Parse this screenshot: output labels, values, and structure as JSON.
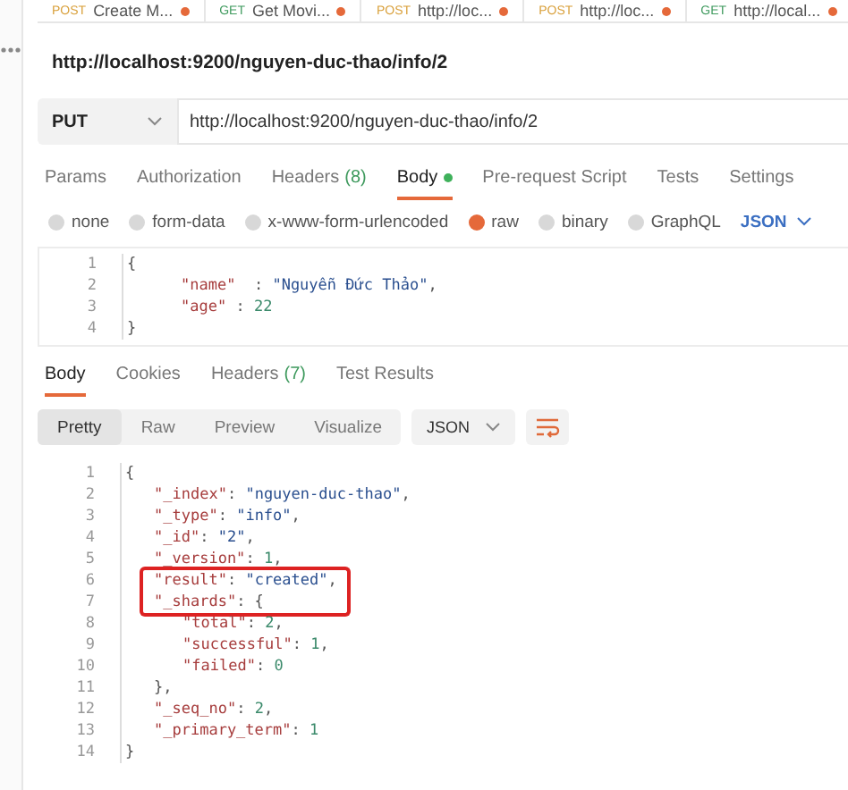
{
  "open_tabs": [
    {
      "method": "POST",
      "label": "Create M...",
      "unsaved": true
    },
    {
      "method": "GET",
      "label": "Get Movi...",
      "unsaved": true
    },
    {
      "method": "POST",
      "label": "http://loc...",
      "unsaved": true
    },
    {
      "method": "POST",
      "label": "http://loc...",
      "unsaved": true
    },
    {
      "method": "GET",
      "label": "http://local...",
      "unsaved": true
    }
  ],
  "request_title": "http://localhost:9200/nguyen-duc-thao/info/2",
  "method": "PUT",
  "url": "http://localhost:9200/nguyen-duc-thao/info/2",
  "request_tabs": [
    {
      "label": "Params",
      "selected": false
    },
    {
      "label": "Authorization",
      "selected": false
    },
    {
      "label": "Headers",
      "count": "(8)",
      "selected": false
    },
    {
      "label": "Body",
      "selected": true,
      "dot": true
    },
    {
      "label": "Pre-request Script",
      "selected": false
    },
    {
      "label": "Tests",
      "selected": false
    },
    {
      "label": "Settings",
      "selected": false
    }
  ],
  "body_types": [
    {
      "label": "none",
      "selected": false
    },
    {
      "label": "form-data",
      "selected": false
    },
    {
      "label": "x-www-form-urlencoded",
      "selected": false
    },
    {
      "label": "raw",
      "selected": true
    },
    {
      "label": "binary",
      "selected": false
    },
    {
      "label": "GraphQL",
      "selected": false
    }
  ],
  "body_format": "JSON",
  "request_body": [
    {
      "number": "1",
      "tokens": [
        {
          "kind": "punct",
          "text": "{"
        }
      ]
    },
    {
      "number": "2",
      "tokens": [
        {
          "kind": "key",
          "text": "\"name\""
        },
        {
          "kind": "punct",
          "text": "  : "
        },
        {
          "kind": "string",
          "text": "\"Nguyễn Đức Thảo\""
        },
        {
          "kind": "punct",
          "text": ","
        }
      ]
    },
    {
      "number": "3",
      "tokens": [
        {
          "kind": "key",
          "text": "\"age\""
        },
        {
          "kind": "punct",
          "text": " : "
        },
        {
          "kind": "number",
          "text": "22"
        }
      ]
    },
    {
      "number": "4",
      "tokens": [
        {
          "kind": "punct",
          "text": "}"
        }
      ]
    }
  ],
  "response_tabs": [
    {
      "label": "Body",
      "selected": true
    },
    {
      "label": "Cookies",
      "selected": false
    },
    {
      "label": "Headers",
      "count": "(7)",
      "selected": false
    },
    {
      "label": "Test Results",
      "selected": false
    }
  ],
  "view_modes": [
    {
      "label": "Pretty",
      "selected": true
    },
    {
      "label": "Raw",
      "selected": false
    },
    {
      "label": "Preview",
      "selected": false
    },
    {
      "label": "Visualize",
      "selected": false
    }
  ],
  "response_format": "JSON",
  "response_body": [
    {
      "number": "1",
      "highlighted": false,
      "tokens": [
        {
          "kind": "punct",
          "text": "{"
        }
      ]
    },
    {
      "number": "2",
      "highlighted": false,
      "tokens": [
        {
          "kind": "key",
          "text": "\"_index\""
        },
        {
          "kind": "punct",
          "text": ": "
        },
        {
          "kind": "string",
          "text": "\"nguyen-duc-thao\""
        },
        {
          "kind": "punct",
          "text": ","
        }
      ]
    },
    {
      "number": "3",
      "highlighted": false,
      "tokens": [
        {
          "kind": "key",
          "text": "\"_type\""
        },
        {
          "kind": "punct",
          "text": ": "
        },
        {
          "kind": "string",
          "text": "\"info\""
        },
        {
          "kind": "punct",
          "text": ","
        }
      ]
    },
    {
      "number": "4",
      "highlighted": false,
      "tokens": [
        {
          "kind": "key",
          "text": "\"_id\""
        },
        {
          "kind": "punct",
          "text": ": "
        },
        {
          "kind": "string",
          "text": "\"2\""
        },
        {
          "kind": "punct",
          "text": ","
        }
      ]
    },
    {
      "number": "5",
      "highlighted": false,
      "tokens": [
        {
          "kind": "key",
          "text": "\"_version\""
        },
        {
          "kind": "punct",
          "text": ": "
        },
        {
          "kind": "number",
          "text": "1"
        },
        {
          "kind": "punct",
          "text": ","
        }
      ]
    },
    {
      "number": "6",
      "highlighted": true,
      "tokens": [
        {
          "kind": "key",
          "text": "\"result\""
        },
        {
          "kind": "punct",
          "text": ": "
        },
        {
          "kind": "string",
          "text": "\"created\""
        },
        {
          "kind": "punct",
          "text": ","
        }
      ]
    },
    {
      "number": "7",
      "highlighted": true,
      "tokens": [
        {
          "kind": "key",
          "text": "\"_shards\""
        },
        {
          "kind": "punct",
          "text": ": {"
        }
      ]
    },
    {
      "number": "8",
      "highlighted": false,
      "tokens": [
        {
          "kind": "key",
          "text": "\"total\""
        },
        {
          "kind": "punct",
          "text": ": "
        },
        {
          "kind": "number",
          "text": "2"
        },
        {
          "kind": "punct",
          "text": ","
        }
      ]
    },
    {
      "number": "9",
      "highlighted": false,
      "tokens": [
        {
          "kind": "key",
          "text": "\"successful\""
        },
        {
          "kind": "punct",
          "text": ": "
        },
        {
          "kind": "number",
          "text": "1"
        },
        {
          "kind": "punct",
          "text": ","
        }
      ]
    },
    {
      "number": "10",
      "highlighted": false,
      "tokens": [
        {
          "kind": "key",
          "text": "\"failed\""
        },
        {
          "kind": "punct",
          "text": ": "
        },
        {
          "kind": "number",
          "text": "0"
        }
      ]
    },
    {
      "number": "11",
      "highlighted": false,
      "tokens": [
        {
          "kind": "punct",
          "text": "},"
        }
      ]
    },
    {
      "number": "12",
      "highlighted": false,
      "tokens": [
        {
          "kind": "key",
          "text": "\"_seq_no\""
        },
        {
          "kind": "punct",
          "text": ": "
        },
        {
          "kind": "number",
          "text": "2"
        },
        {
          "kind": "punct",
          "text": ","
        }
      ]
    },
    {
      "number": "13",
      "highlighted": false,
      "tokens": [
        {
          "kind": "key",
          "text": "\"_primary_term\""
        },
        {
          "kind": "punct",
          "text": ": "
        },
        {
          "kind": "number",
          "text": "1"
        }
      ]
    },
    {
      "number": "14",
      "highlighted": false,
      "tokens": [
        {
          "kind": "punct",
          "text": "}"
        }
      ]
    }
  ]
}
